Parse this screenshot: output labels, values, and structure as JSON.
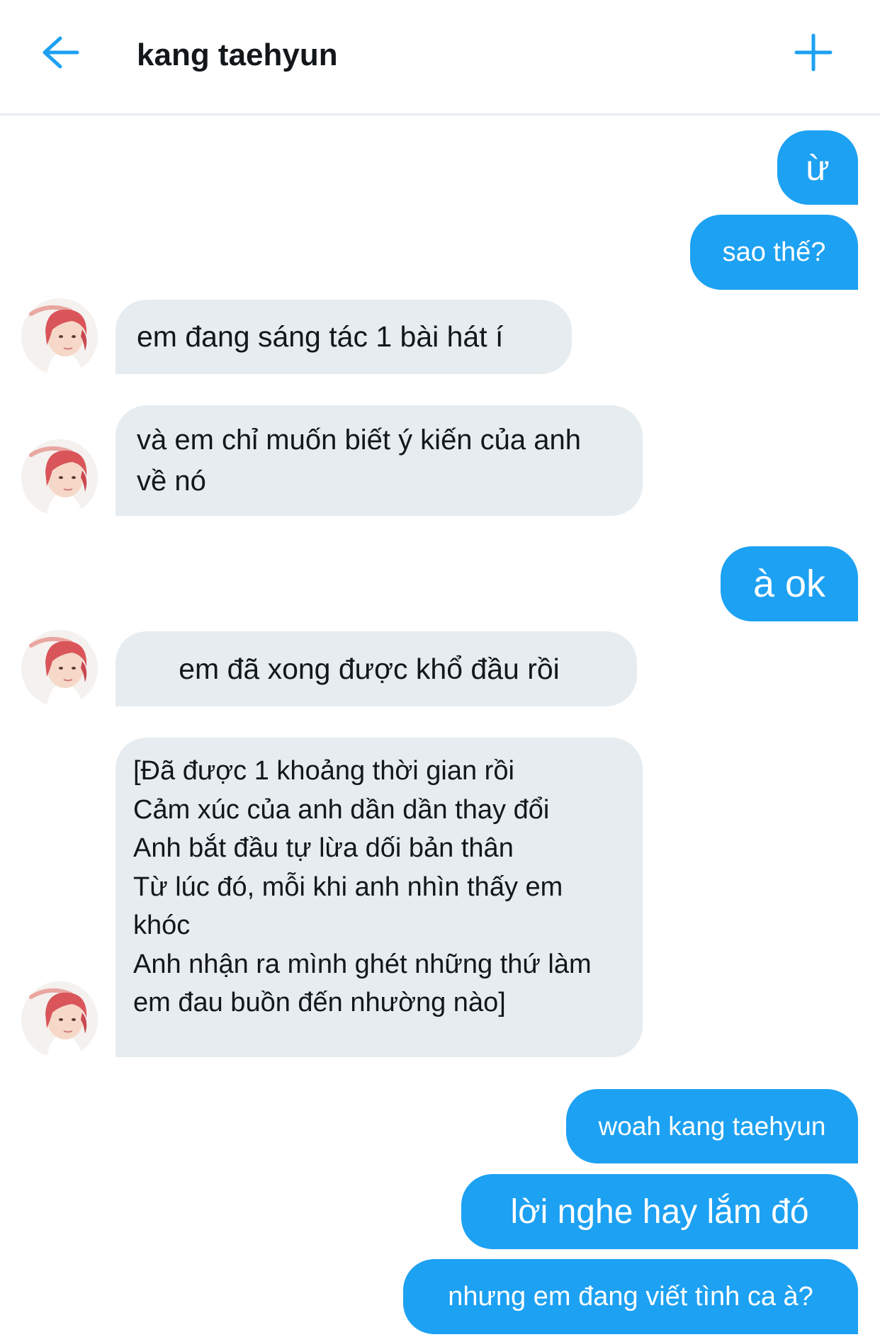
{
  "header": {
    "title": "kang taehyun"
  },
  "messages": [
    {
      "dir": "out",
      "text": "ừ"
    },
    {
      "dir": "out",
      "text": "sao thế?"
    },
    {
      "dir": "in",
      "text": "em đang sáng tác 1 bài hát í"
    },
    {
      "dir": "in",
      "lines": [
        "và em chỉ muốn biết ý kiến của anh",
        "về nó"
      ]
    },
    {
      "dir": "out",
      "text": "à ok"
    },
    {
      "dir": "in",
      "text": "em đã xong được khổ đầu rồi"
    },
    {
      "dir": "in",
      "lines": [
        "[Đã được 1 khoảng thời gian rồi",
        "Cảm xúc của anh dần dần thay đổi",
        "Anh bắt đầu tự lừa dối bản thân",
        "Từ lúc đó, mỗi khi anh nhìn thấy em",
        "khóc",
        "Anh nhận ra mình ghét những thứ làm",
        "em đau buồn đến nhường nào]"
      ]
    },
    {
      "dir": "out",
      "text": "woah kang taehyun"
    },
    {
      "dir": "out",
      "text": "lời nghe hay lắm đó"
    },
    {
      "dir": "out",
      "text": "nhưng em đang viết tình ca à?"
    }
  ],
  "colors": {
    "outgoing_bubble": "#1da1f2",
    "incoming_bubble": "#e6ecf0",
    "accent": "#1da1f2"
  },
  "icons": {
    "back": "arrow-left-icon",
    "new": "plus-icon",
    "avatar": "avatar-photo"
  }
}
